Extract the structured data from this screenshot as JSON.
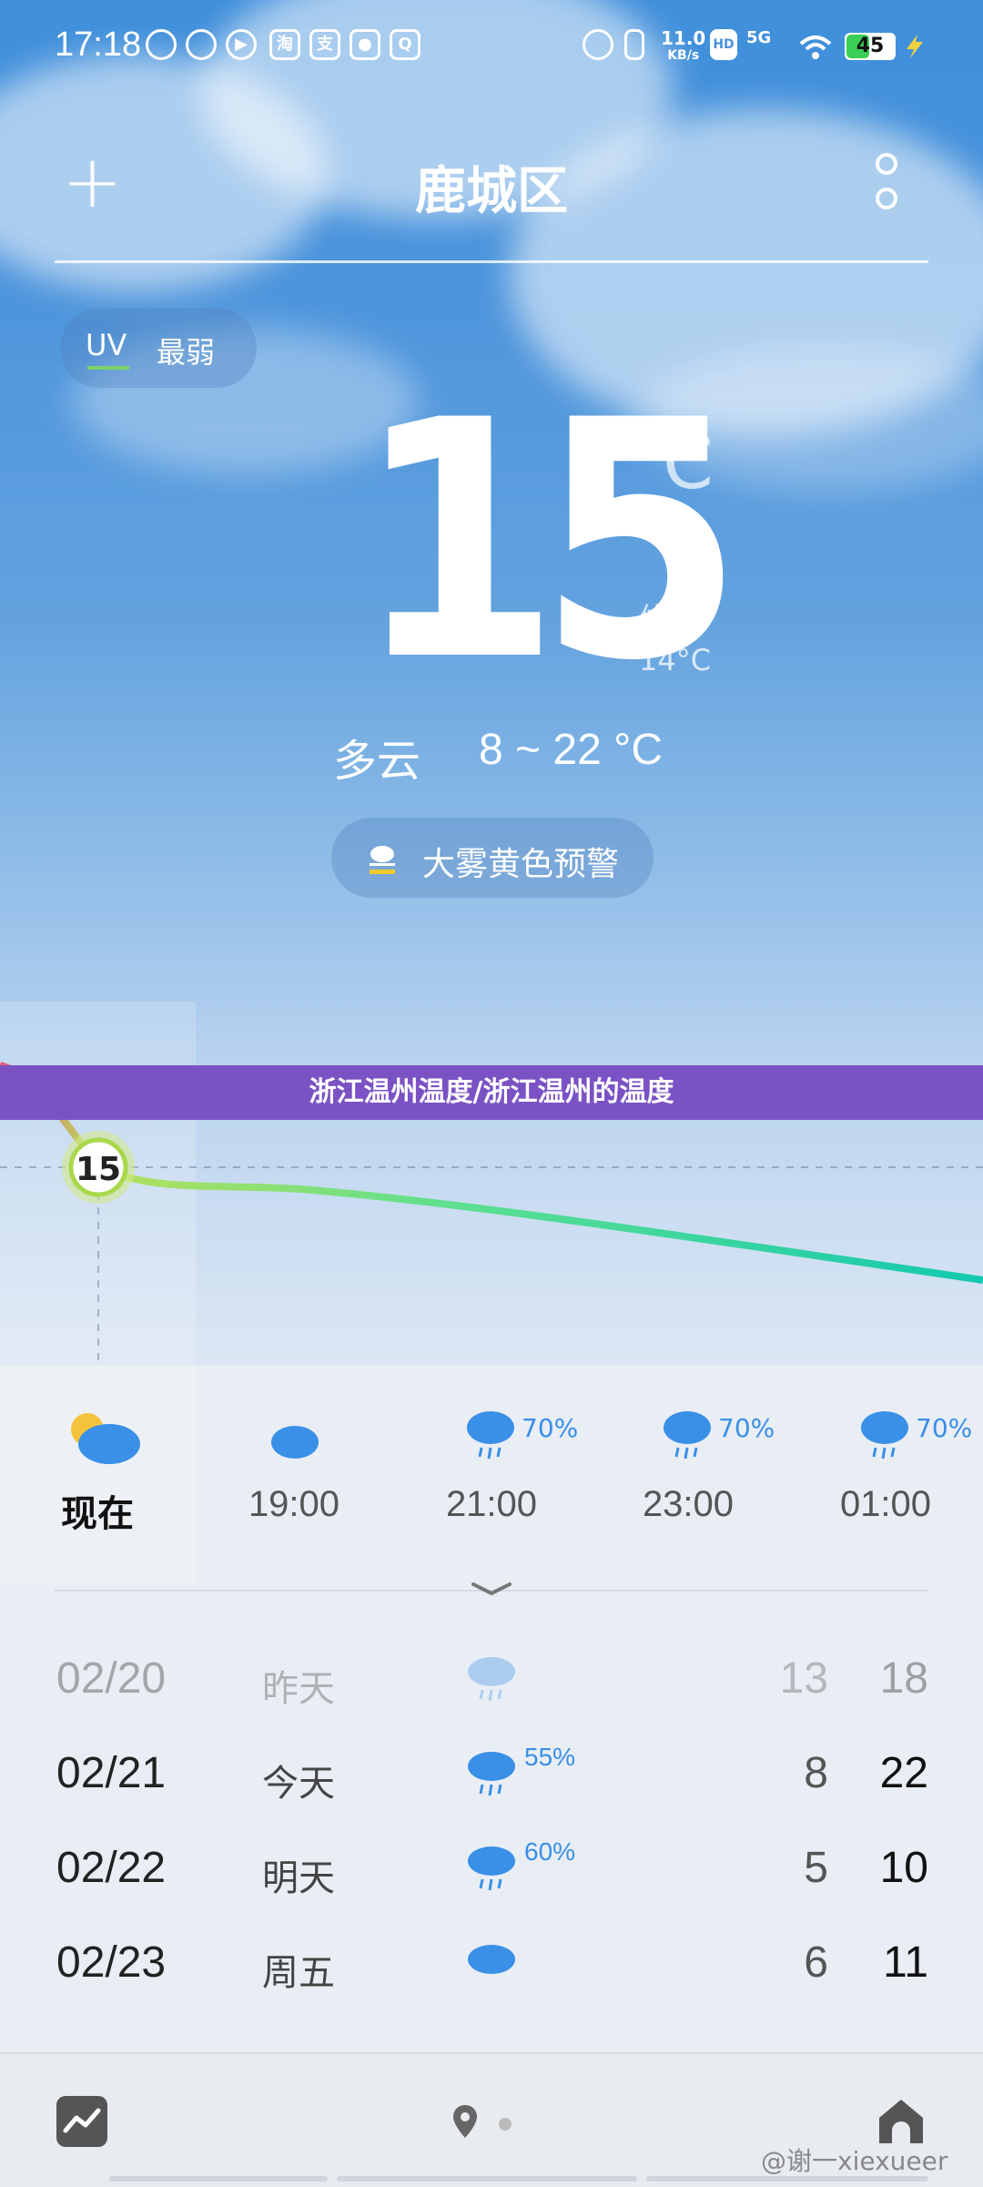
{
  "status_bar": {
    "time": "17:18",
    "net_speed": "11.0",
    "net_unit": "KB/s",
    "hd": "HD",
    "signal": "5G",
    "battery": "45",
    "battery_color": "#3bcf55",
    "app_icons": [
      "message-icon",
      "weibo-icon",
      "play-icon",
      "taobao-icon",
      "alipay-icon",
      "app-icon",
      "qq-icon"
    ]
  },
  "header": {
    "add_label": "+",
    "city": "鹿城区"
  },
  "uv": {
    "label": "UV",
    "value": "最弱"
  },
  "current": {
    "temperature": "15",
    "unit": "°C",
    "feels_label": "体感",
    "feels_value": "14°C",
    "condition": "多云",
    "range": "8 ~ 22 °C"
  },
  "alert": {
    "text": "大雾黄色预警",
    "icon": "fog-warning-icon"
  },
  "banner": {
    "text": "浙江温州温度/浙江温州的温度",
    "color": "#7b52c4"
  },
  "chart_data": {
    "type": "line",
    "current_label": "15",
    "series": [
      {
        "values": [
          15
        ]
      }
    ]
  },
  "hourly": [
    {
      "time": "现在",
      "icon": "partly-cloudy-icon",
      "precip": ""
    },
    {
      "time": "19:00",
      "icon": "night-cloudy-icon",
      "precip": ""
    },
    {
      "time": "21:00",
      "icon": "rain-icon",
      "precip": "70%"
    },
    {
      "time": "23:00",
      "icon": "rain-icon",
      "precip": "70%"
    },
    {
      "time": "01:00",
      "icon": "rain-icon",
      "precip": "70%"
    }
  ],
  "daily": [
    {
      "date": "02/20",
      "name": "昨天",
      "icon": "rain-icon",
      "precip": "",
      "low": "13",
      "high": "18"
    },
    {
      "date": "02/21",
      "name": "今天",
      "icon": "rain-icon",
      "precip": "55%",
      "low": "8",
      "high": "22"
    },
    {
      "date": "02/22",
      "name": "明天",
      "icon": "rain-icon",
      "precip": "60%",
      "low": "5",
      "high": "10"
    },
    {
      "date": "02/23",
      "name": "周五",
      "icon": "cloudy-icon",
      "precip": "",
      "low": "6",
      "high": "11"
    }
  ],
  "watermark": "@谢一xiexueer",
  "accent_color": "#3a8fe6"
}
